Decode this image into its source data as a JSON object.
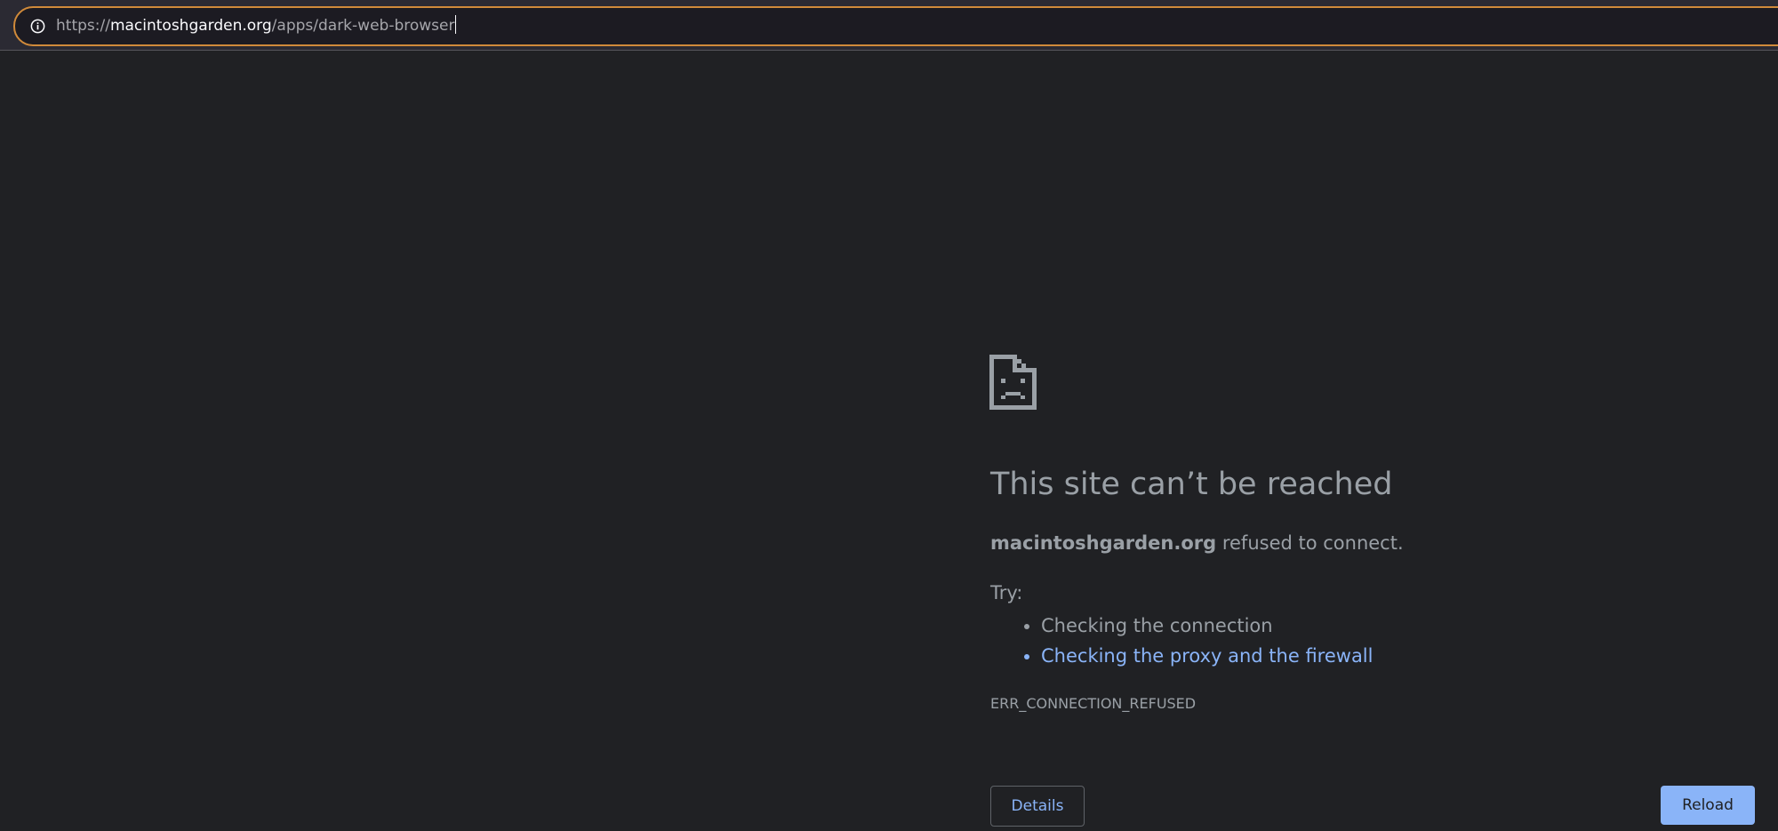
{
  "address_bar": {
    "scheme": "https://",
    "host": "macintoshgarden.org",
    "path": "/apps/dark-web-browser",
    "focus_color": "#d08a3a"
  },
  "error_page": {
    "icon": "sad-document-icon",
    "title": "This site can’t be reached",
    "host": "macintoshgarden.org",
    "message": " refused to connect.",
    "try_label": "Try:",
    "suggestions": [
      "Checking the connection",
      "Checking the proxy and the firewall"
    ],
    "error_code": "ERR_CONNECTION_REFUSED",
    "details_label": "Details",
    "reload_label": "Reload",
    "link_color": "#8ab4f8",
    "background": "#202124"
  }
}
